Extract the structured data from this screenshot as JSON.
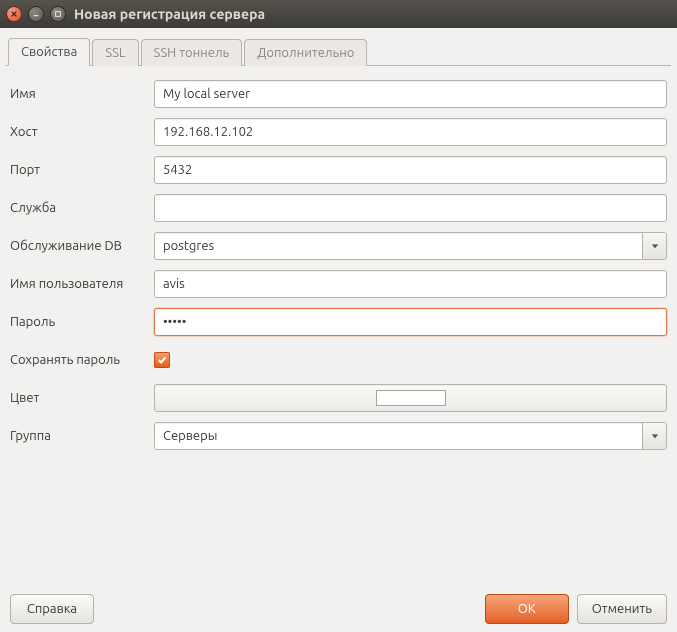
{
  "window": {
    "title": "Новая регистрация сервера"
  },
  "tabs": [
    {
      "label": "Свойства",
      "active": true
    },
    {
      "label": "SSL",
      "active": false
    },
    {
      "label": "SSH тоннель",
      "active": false
    },
    {
      "label": "Дополнительно",
      "active": false
    }
  ],
  "form": {
    "name": {
      "label": "Имя",
      "value": "My local server"
    },
    "host": {
      "label": "Хост",
      "value": "192.168.12.102"
    },
    "port": {
      "label": "Порт",
      "value": "5432"
    },
    "service": {
      "label": "Служба",
      "value": ""
    },
    "maint_db": {
      "label": "Обслуживание DB",
      "value": "postgres"
    },
    "username": {
      "label": "Имя пользователя",
      "value": "avis"
    },
    "password": {
      "label": "Пароль",
      "value": "•••••"
    },
    "save_pw": {
      "label": "Сохранять пароль",
      "checked": true
    },
    "color": {
      "label": "Цвет",
      "swatch": "#ffffff"
    },
    "group": {
      "label": "Группа",
      "value": "Серверы"
    }
  },
  "buttons": {
    "help": "Справка",
    "ok": "OK",
    "cancel": "Отменить"
  }
}
